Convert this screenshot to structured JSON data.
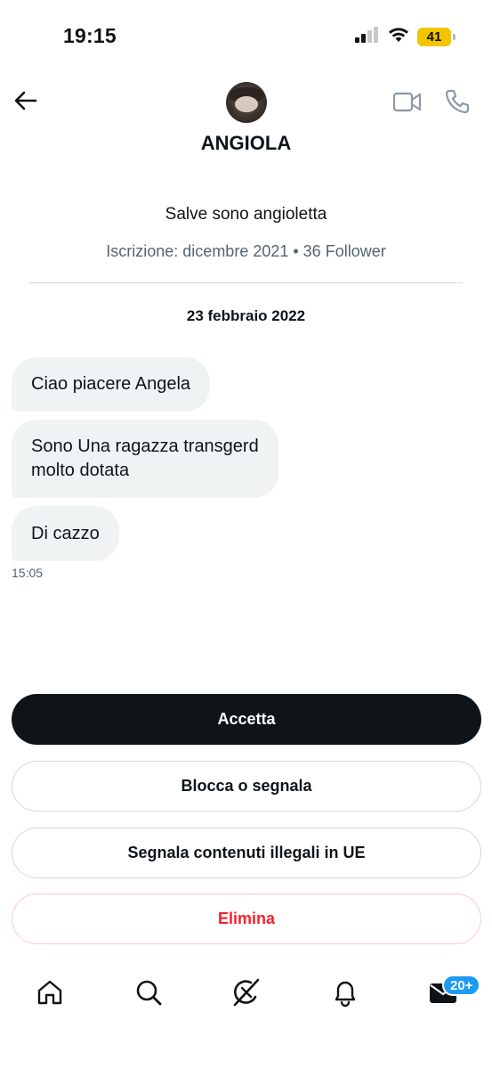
{
  "status_bar": {
    "time": "19:15",
    "battery": "41"
  },
  "header": {
    "name": "ANGIOLA"
  },
  "profile": {
    "bio": "Salve sono angioletta",
    "meta": "Iscrizione: dicembre 2021 • 36 Follower"
  },
  "conversation": {
    "date": "23 febbraio 2022",
    "messages": [
      {
        "text": "Ciao piacere Angela"
      },
      {
        "line1": "Sono Una ragazza transgerd",
        "line2": "molto dotata"
      },
      {
        "text": "Di cazzo"
      }
    ],
    "time": "15:05"
  },
  "actions": {
    "accept": "Accetta",
    "block": "Blocca o segnala",
    "report": "Segnala contenuti illegali in UE",
    "delete": "Elimina"
  },
  "nav": {
    "messages_badge": "20+"
  },
  "colors": {
    "primary_text": "#0f1419",
    "secondary_text": "#536471",
    "bubble": "#eff3f4",
    "danger": "#f4212e",
    "accent": "#1d9bf0",
    "battery": "#f2c500"
  },
  "icons": [
    "signal-icon",
    "wifi-icon",
    "back-arrow-icon",
    "video-call-icon",
    "phone-call-icon",
    "home-icon",
    "search-icon",
    "grok-icon",
    "bell-icon",
    "mail-icon"
  ]
}
